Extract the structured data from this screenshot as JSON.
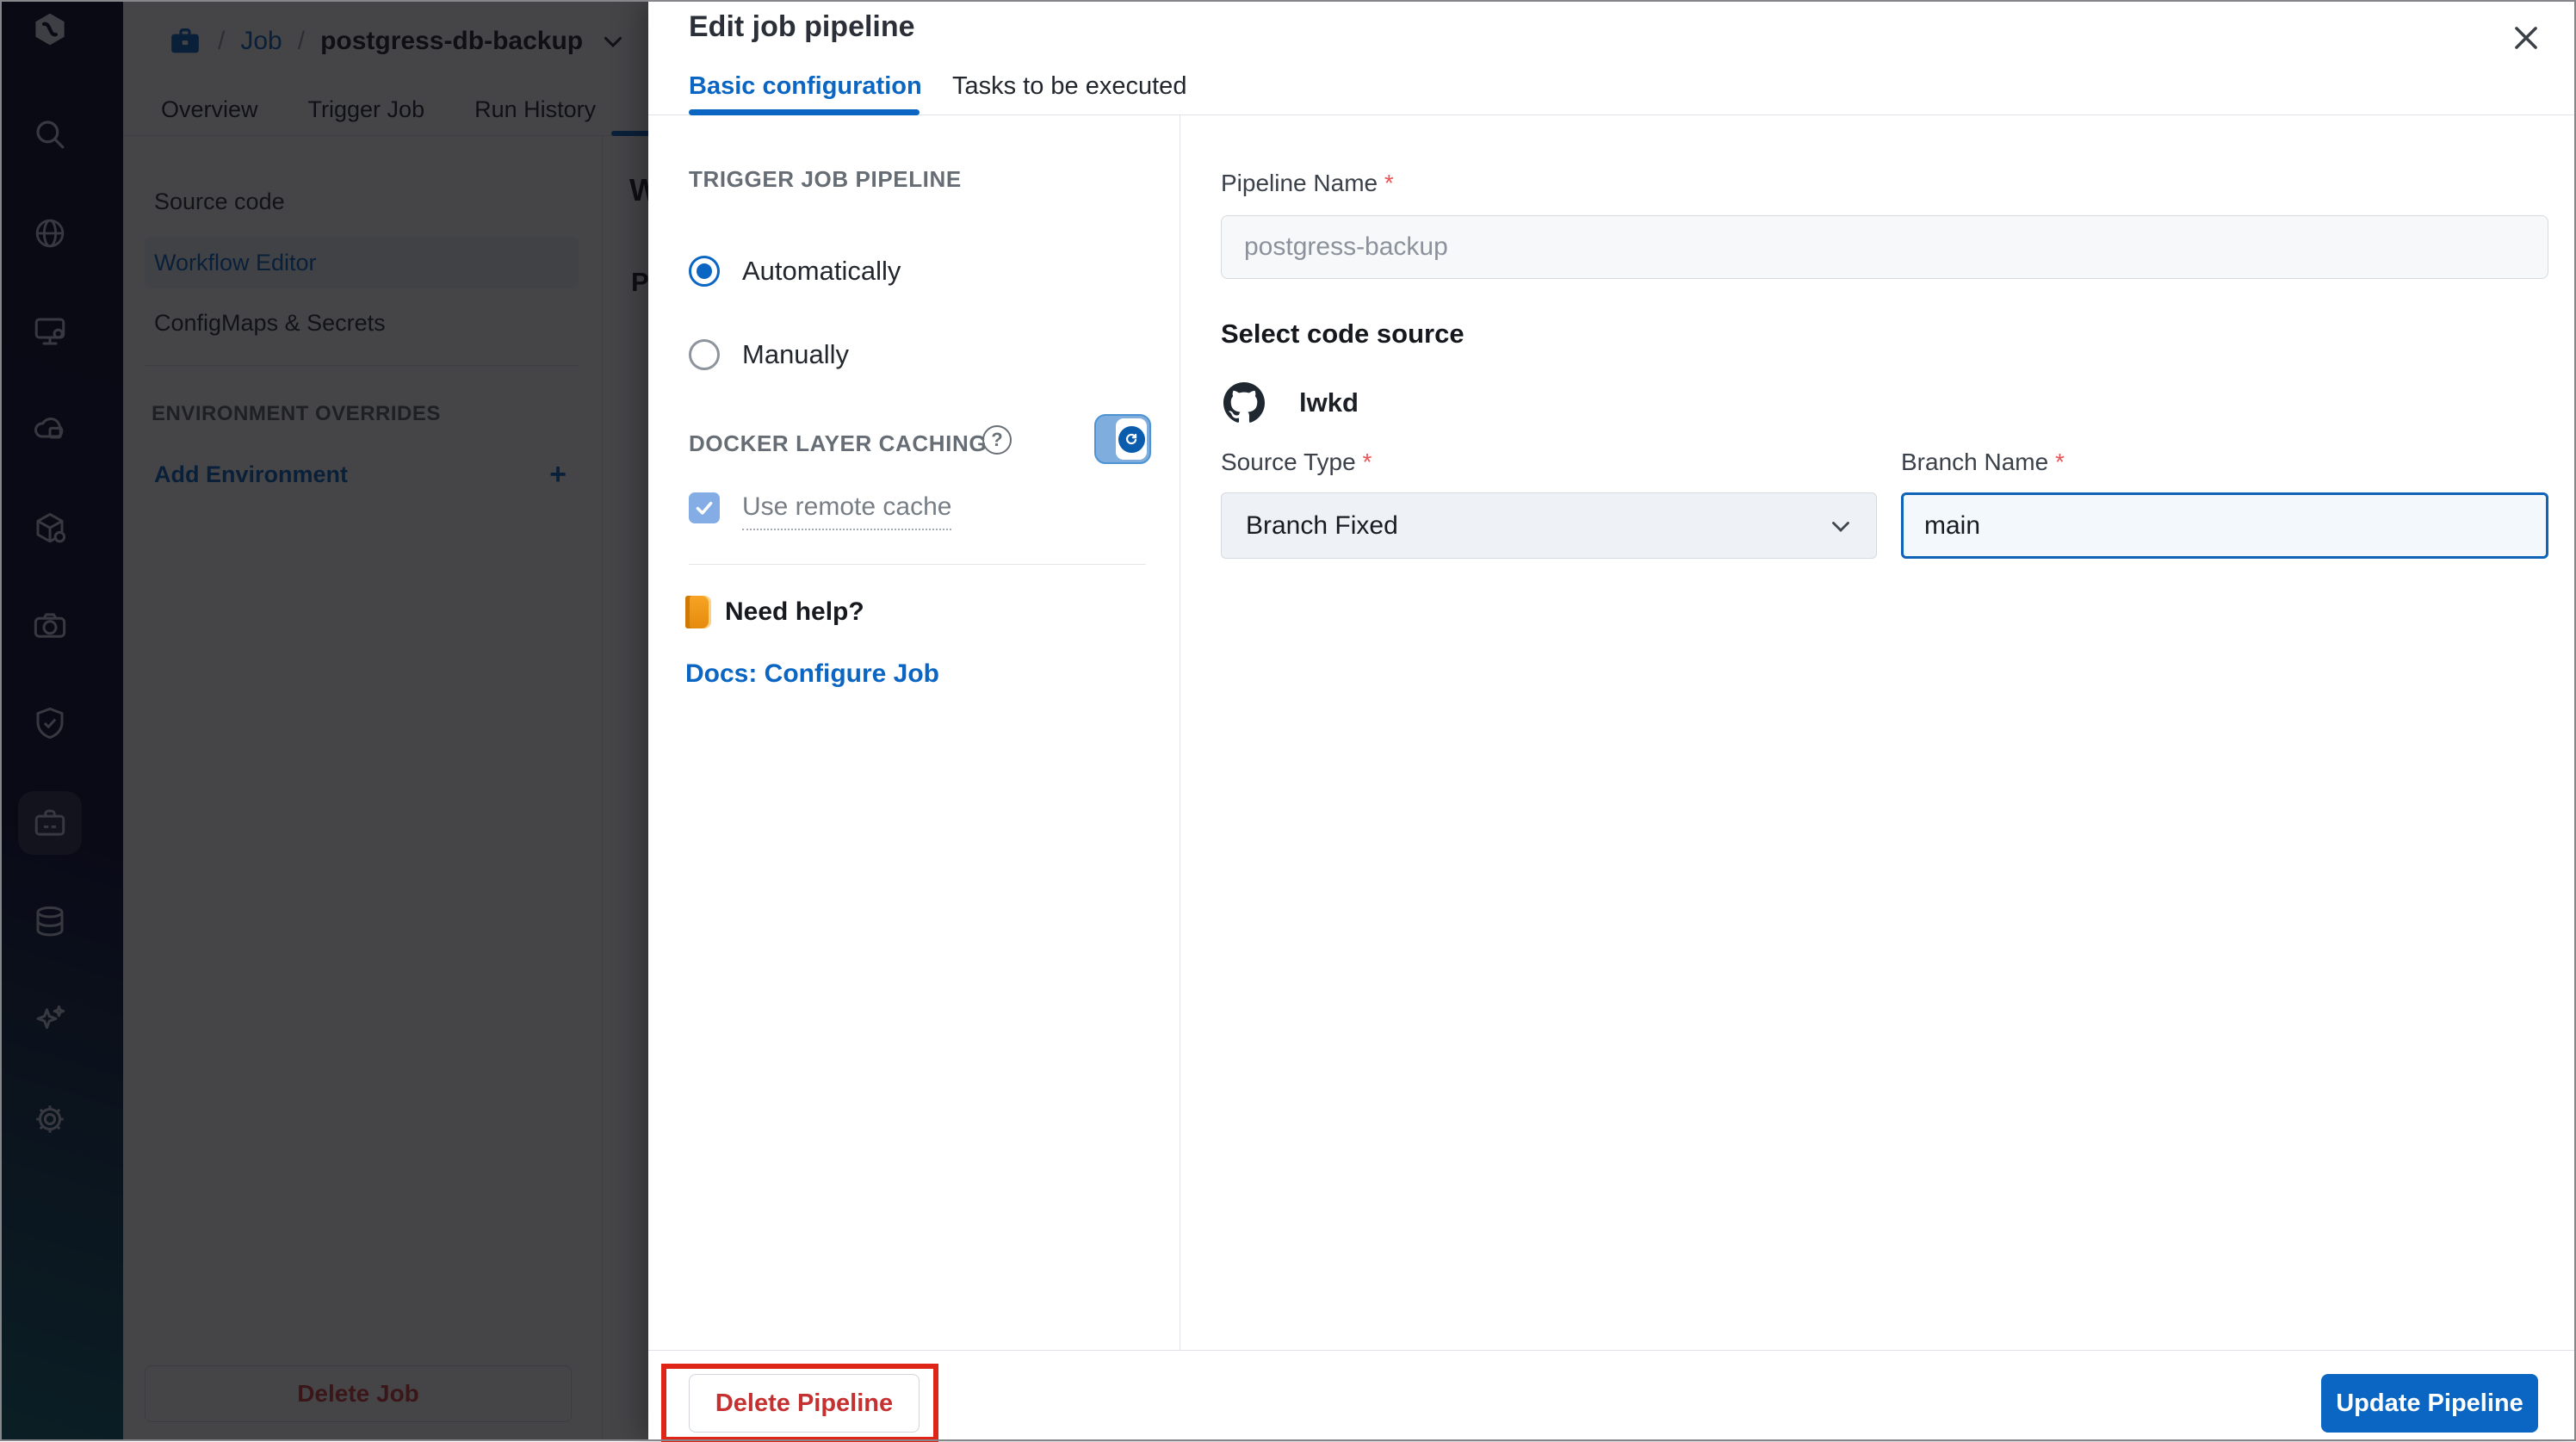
{
  "colors": {
    "accent_blue": "#0a66c2",
    "danger_red": "#d23b3b",
    "annotation_red": "#de2517",
    "toggle_track_blue": "#7fadde",
    "checkbox_blue": "#84ade5",
    "sidebar_teal": "#0f5f6d"
  },
  "sidebar": {
    "icons": [
      "devtron-logo",
      "search",
      "global-config",
      "deployments",
      "build-pipelines",
      "app-store",
      "observability",
      "security",
      "jobs",
      "resource-browser",
      "sparkles",
      "settings"
    ],
    "active_icon": "jobs"
  },
  "topbar": {
    "breadcrumb": {
      "sep": "/",
      "job": "Job",
      "name": "postgress-db-backup"
    },
    "tabs": [
      "Overview",
      "Trigger Job",
      "Run History"
    ]
  },
  "nav": {
    "items": [
      {
        "label": "Source code",
        "active": false
      },
      {
        "label": "Workflow Editor",
        "active": true
      },
      {
        "label": "ConfigMaps & Secrets",
        "active": false
      }
    ],
    "section_header": "ENVIRONMENT OVERRIDES",
    "add_environment": "Add Environment",
    "plus": "+",
    "delete_job_button": "Delete Job"
  },
  "background_fragments": {
    "clipped_heading": "W",
    "clipped_text": "P"
  },
  "modal": {
    "title": "Edit job pipeline",
    "tabs": [
      {
        "label": "Basic configuration",
        "active": true
      },
      {
        "label": "Tasks to be executed",
        "active": false
      }
    ],
    "left": {
      "trigger_header": "TRIGGER JOB PIPELINE",
      "radios": [
        {
          "label": "Automatically",
          "selected": true
        },
        {
          "label": "Manually",
          "selected": false
        }
      ],
      "dlc_header": "DOCKER LAYER CACHING",
      "help_glyph": "?",
      "use_remote_cache": "Use remote cache",
      "need_help": "Need help?",
      "docs_link": "Docs: Configure Job"
    },
    "right": {
      "pipeline_name_label": "Pipeline Name",
      "required": "*",
      "pipeline_name_value": "postgress-backup",
      "select_code_source": "Select code source",
      "repo": "lwkd",
      "source_type_label": "Source Type",
      "source_type_value": "Branch Fixed",
      "branch_name_label": "Branch Name",
      "branch_name_value": "main"
    },
    "footer": {
      "delete_button": "Delete Pipeline",
      "update_button": "Update Pipeline"
    }
  }
}
